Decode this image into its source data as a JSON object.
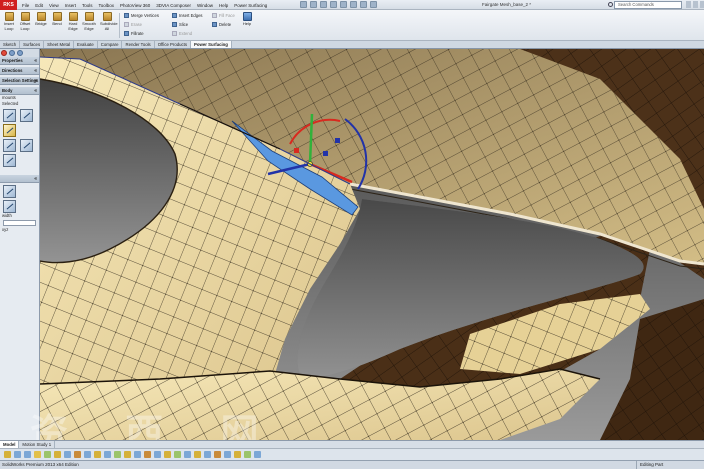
{
  "app": {
    "logo_text": "DS SOLIDWORKS",
    "logo_visible": "RKS",
    "document_title": "Fairgate Mesh_base_2 *",
    "search_placeholder": "Search Commands",
    "menus": [
      "File",
      "Edit",
      "View",
      "Insert",
      "Tools",
      "Toolbox",
      "PhotoView 360",
      "3DVIA Composer",
      "Window",
      "Help",
      "Power Surfacing"
    ]
  },
  "ribbon": {
    "buttons": [
      {
        "label": "Insert Loop",
        "icon": "insert-loop-icon"
      },
      {
        "label": "Offset Loop",
        "icon": "offset-loop-icon"
      },
      {
        "label": "Bridge",
        "icon": "bridge-icon"
      },
      {
        "label": "Bend",
        "icon": "bend-icon"
      },
      {
        "label": "Hard Edge",
        "icon": "hard-edge-icon"
      },
      {
        "label": "Smooth Edge",
        "icon": "smooth-edge-icon"
      },
      {
        "label": "Subdivide All",
        "icon": "subdivide-icon"
      }
    ],
    "small_left": [
      {
        "label": "Merge Vertices",
        "enabled": true
      },
      {
        "label": "Erase",
        "enabled": false
      },
      {
        "label": "Fillrate",
        "enabled": true
      }
    ],
    "small_mid": [
      {
        "label": "Insert Edges",
        "enabled": true
      },
      {
        "label": "Slice",
        "enabled": true
      },
      {
        "label": "Extend",
        "enabled": false
      }
    ],
    "small_right": [
      {
        "label": "Fill Face",
        "enabled": false
      },
      {
        "label": "Delete",
        "enabled": true
      }
    ],
    "help_label": "Help"
  },
  "command_tabs": [
    {
      "label": "Sketch",
      "active": false
    },
    {
      "label": "Surfaces",
      "active": false
    },
    {
      "label": "Sheet Metal",
      "active": false
    },
    {
      "label": "Evaluate",
      "active": false
    },
    {
      "label": "Compare",
      "active": false
    },
    {
      "label": "Render Tools",
      "active": false
    },
    {
      "label": "Office Products",
      "active": false
    },
    {
      "label": "Power Surfacing",
      "active": true
    }
  ],
  "property_manager": {
    "title": "Properties",
    "section_directions": "Directions",
    "section_selection_settings": "Selection Settings",
    "section_body": "Body",
    "row_mounts": "mounts",
    "row_selected": "Selected",
    "row_width": "width",
    "row_xyz": "xyz"
  },
  "bottom_tabs": [
    {
      "label": "Model",
      "active": true
    },
    {
      "label": "Motion Study 1",
      "active": false
    }
  ],
  "status": {
    "left": "SolidWorks Premium 2013 x64 Edition",
    "right": "Editing Part"
  },
  "watermark": {
    "text": "资 西 网",
    "url": "www.3dmax.com"
  },
  "colors": {
    "mesh_face": "#f1dfa8",
    "mesh_face_shadow": "#d8c188",
    "mesh_back": "#4a2f17",
    "selected_face": "#5a98e0",
    "background_top": "#3e3e3e",
    "background_bottom": "#8f8f8f",
    "accent_red": "#d01f1f"
  }
}
